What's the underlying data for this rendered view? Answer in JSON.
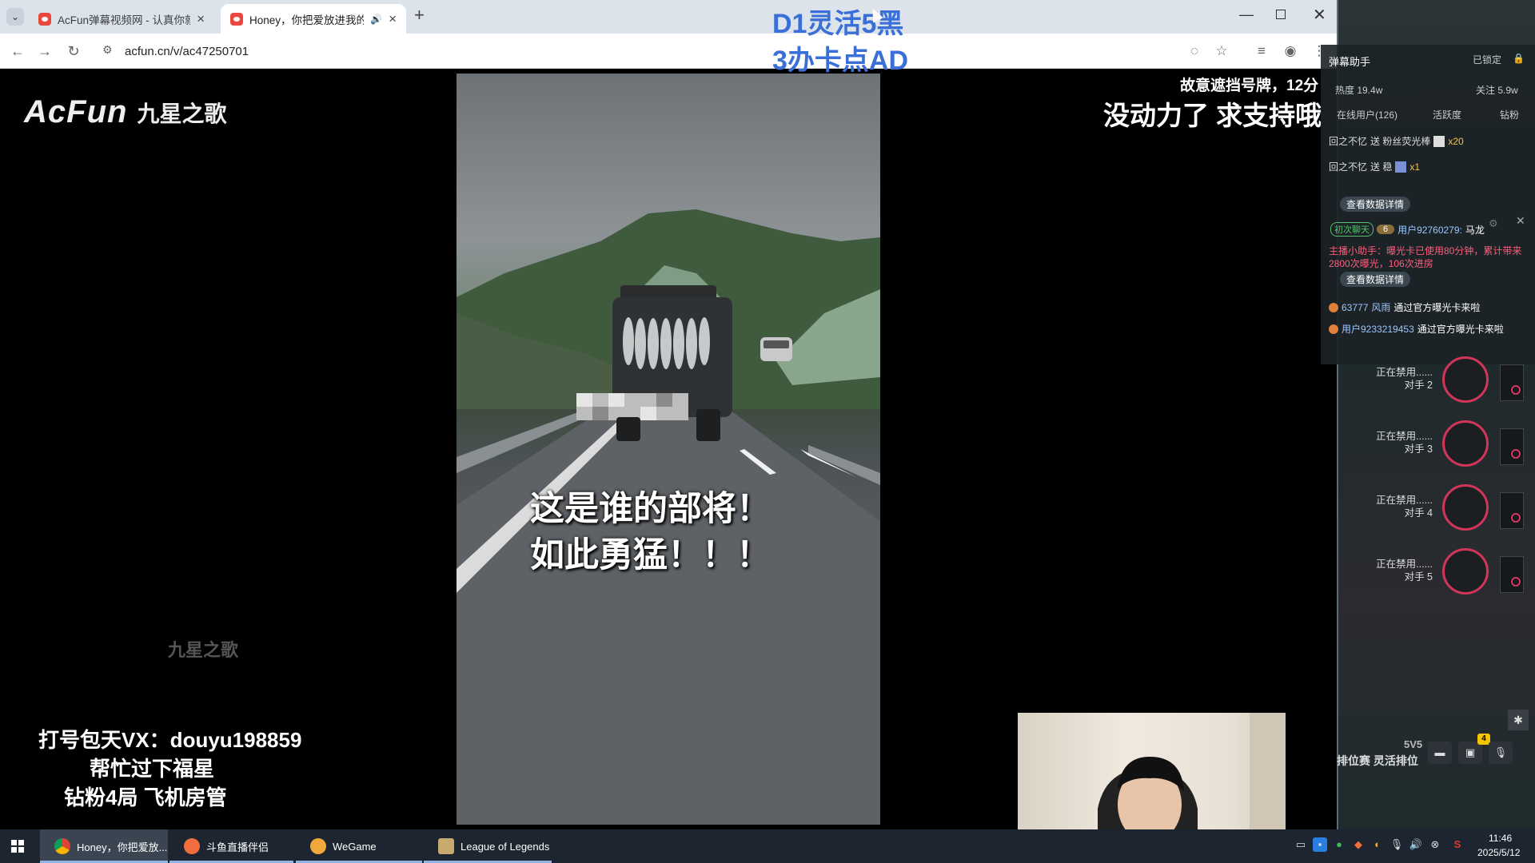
{
  "browser": {
    "tabs": [
      {
        "title": "AcFun弹幕视频网 - 认真你就输"
      },
      {
        "title": "Honey，你把爱放进我的心"
      }
    ],
    "url": "acfun.cn/v/ac47250701"
  },
  "video": {
    "logo_brand": "AcFun",
    "logo_sub": "九星之歌",
    "watermark": "九星之歌",
    "subtitle_line1": "这是谁的部将！",
    "subtitle_line2": "如此勇猛！！！"
  },
  "overlays": {
    "top_center_line1": "D1灵活5黑",
    "top_center_line2": "3办卡点AD",
    "top_right_small": "故意遮挡号牌，12分",
    "top_right_big": "没动力了 求支持哦",
    "bottom_left_line1": "打号包天VX：douyu198859",
    "bottom_left_line2": "帮忙过下福星",
    "bottom_left_line3": "钻粉4局  飞机房管"
  },
  "danmu_panel": {
    "title": "弹幕助手",
    "lock_label": "已锁定",
    "heat": "热度 19.4w",
    "follow": "关注 5.9w",
    "online": "在线用户(126)",
    "activity": "活跃度",
    "diamond": "钻粉",
    "gift1_user": "回之不忆",
    "gift1_action": "送 粉丝荧光棒",
    "gift1_count": "x20",
    "gift2_user": "回之不忆",
    "gift2_action": "送 稳",
    "gift2_count": "x1",
    "detail_btn": "查看数据详情",
    "chat_badge": "初次聊天",
    "chat_level": "6",
    "chat_user": "用户92760279:",
    "chat_msg": "马龙",
    "assistant_msg": "主播小助手：曝光卡已使用80分钟，累计带来2800次曝光，106次进房",
    "detail_btn2": "查看数据详情",
    "enter1_user": "63777",
    "enter1_name": "风雨",
    "enter1_msg": "通过官方曝光卡来啦",
    "enter2_user": "用户9233219453",
    "enter2_msg": "通过官方曝光卡来啦"
  },
  "ban_list": [
    {
      "status": "正在禁用......",
      "label": "对手 2"
    },
    {
      "status": "正在禁用......",
      "label": "对手 3"
    },
    {
      "status": "正在禁用......",
      "label": "对手 4"
    },
    {
      "status": "正在禁用......",
      "label": "对手 5"
    }
  ],
  "bottom_right": {
    "mode_top": "5V5",
    "mode_bottom": "排位赛 灵活排位",
    "notif_count": "4"
  },
  "taskbar": {
    "apps": [
      {
        "label": "Honey，你把爱放..."
      },
      {
        "label": "斗鱼直播伴侣"
      },
      {
        "label": "WeGame"
      },
      {
        "label": "League of Legends"
      }
    ],
    "time": "11:46",
    "date": "2025/5/12"
  },
  "colors": {
    "accent_blue": "#3a6fd8",
    "ban_ring": "#d1365a",
    "taskbar": "#1c2530"
  }
}
